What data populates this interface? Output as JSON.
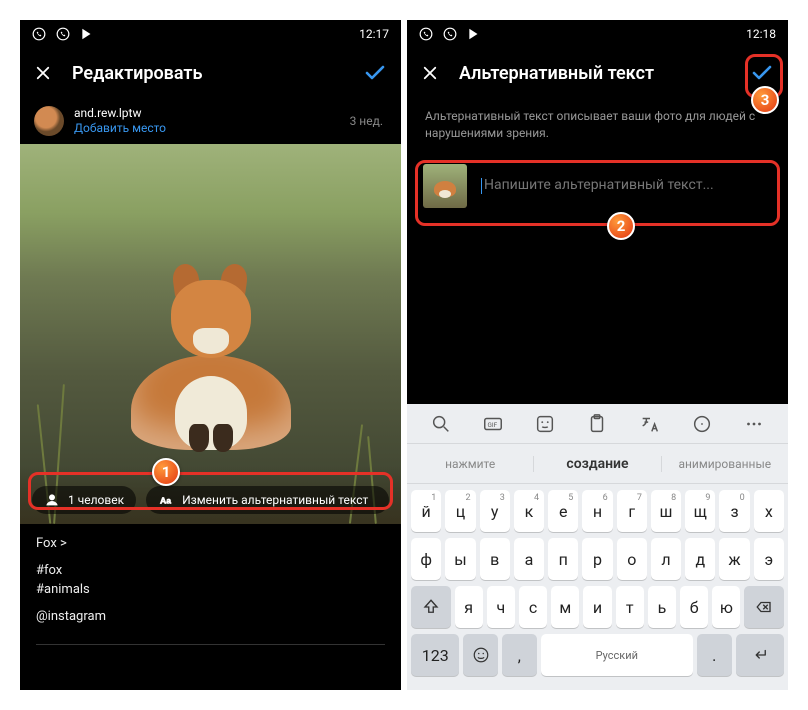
{
  "left": {
    "status_time": "12:17",
    "title": "Редактировать",
    "username": "and.rew.lptw",
    "add_place": "Добавить место",
    "time_ago": "3 нед.",
    "tagged_label": "1 человек",
    "alt_btn_label": "Изменить альтернативный текст",
    "caption_line1": "Fox >",
    "hashtag1": "#fox",
    "hashtag2": "#animals",
    "mention": "@instagram"
  },
  "right": {
    "status_time": "12:18",
    "title": "Альтернативный текст",
    "description": "Альтернативный текст описывает ваши фото для людей с нарушениями зрения.",
    "placeholder": "Напишите альтернативный текст..."
  },
  "keyboard": {
    "sug_left": "нажмите",
    "sug_mid": "создание",
    "sug_right": "анимированные",
    "row1": [
      {
        "l": "й",
        "s": "1"
      },
      {
        "l": "ц",
        "s": "2"
      },
      {
        "l": "у",
        "s": "3"
      },
      {
        "l": "к",
        "s": "4"
      },
      {
        "l": "е",
        "s": "5"
      },
      {
        "l": "н",
        "s": "6"
      },
      {
        "l": "г",
        "s": "7"
      },
      {
        "l": "ш",
        "s": "8"
      },
      {
        "l": "щ",
        "s": "9"
      },
      {
        "l": "з",
        "s": "0"
      },
      {
        "l": "х",
        "s": ""
      }
    ],
    "row2": [
      "ф",
      "ы",
      "в",
      "а",
      "п",
      "р",
      "о",
      "л",
      "д",
      "ж",
      "э"
    ],
    "row3": [
      "я",
      "ч",
      "с",
      "м",
      "и",
      "т",
      "ь",
      "б",
      "ю"
    ],
    "num_label": "123",
    "space_label": "Русский"
  },
  "badges": {
    "b1": "1",
    "b2": "2",
    "b3": "3"
  }
}
